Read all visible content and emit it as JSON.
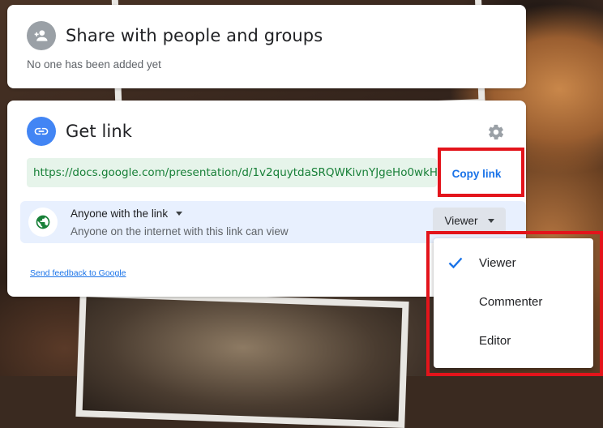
{
  "share_card": {
    "title": "Share with people and groups",
    "subtitle": "No one has been added yet",
    "icon": "person-add-icon"
  },
  "link_card": {
    "title": "Get link",
    "icon": "link-icon",
    "settings_icon": "gear-icon",
    "url": "https://docs.google.com/presentation/d/1v2quytdaSRQWKivnYJgeHo0wkH...",
    "copy_label": "Copy link",
    "access": {
      "icon": "globe-icon",
      "label": "Anyone with the link",
      "description": "Anyone on the internet with this link can view",
      "role_label": "Viewer"
    },
    "feedback_label": "Send feedback to Google"
  },
  "role_menu": {
    "items": [
      {
        "label": "Viewer",
        "selected": true
      },
      {
        "label": "Commenter",
        "selected": false
      },
      {
        "label": "Editor",
        "selected": false
      }
    ]
  },
  "colors": {
    "accent": "#1a73e8",
    "url_text": "#188038",
    "url_bg": "#e6f4ea",
    "highlight": "#e3141b",
    "access_bg": "#e8f0fe"
  }
}
